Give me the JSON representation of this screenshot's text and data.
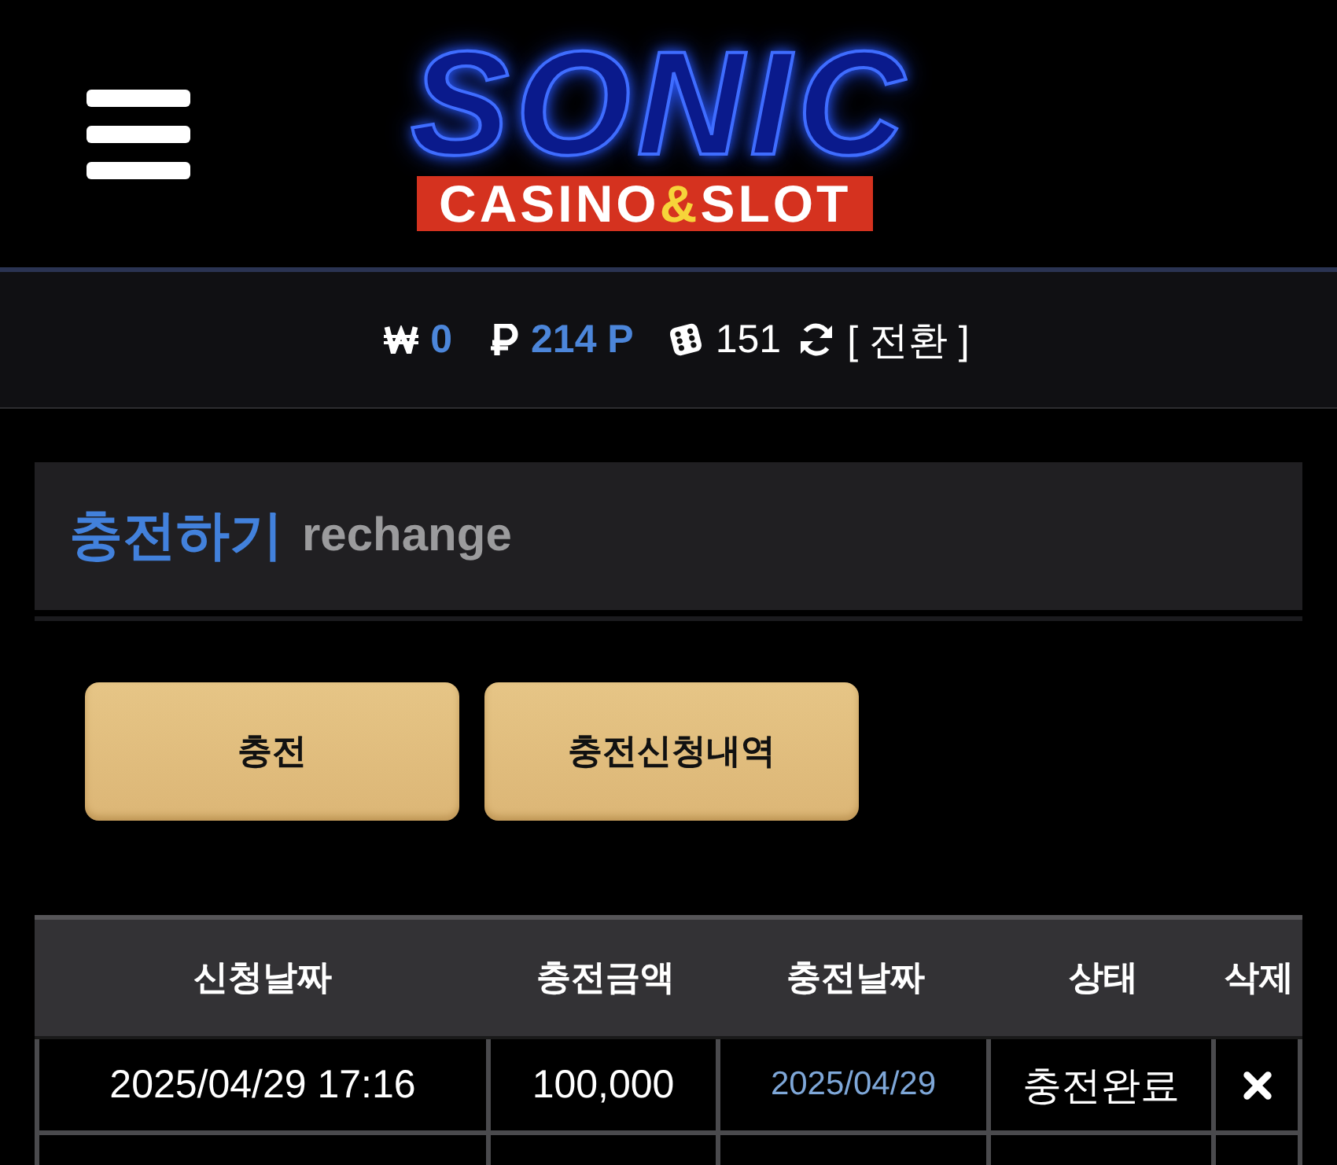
{
  "header": {
    "logo": {
      "title": "SONIC",
      "subtitle_parts": [
        {
          "text": "CASINO",
          "kind": "plain"
        },
        {
          "text": "&",
          "kind": "accent"
        },
        {
          "text": "SLOT",
          "kind": "plain"
        }
      ]
    }
  },
  "balances": [
    {
      "kind": "won",
      "value": "0"
    },
    {
      "kind": "point",
      "value": "214 P"
    },
    {
      "kind": "dice",
      "value": "151"
    }
  ],
  "switch": {
    "label": "[ 전환 ]"
  },
  "section": {
    "title": "충전하기",
    "subtitle": "rechange"
  },
  "buttons": [
    {
      "label": "충전"
    },
    {
      "label": "충전신청내역"
    }
  ],
  "table": {
    "columns": [
      "신청날짜",
      "충전금액",
      "충전날짜",
      "상태",
      "삭제"
    ],
    "rows": [
      {
        "requested_at": "2025/04/29 17:16",
        "amount": "100,000",
        "charged_at": "2025/04/29",
        "status": "충전완료"
      }
    ],
    "more_rows_below": true
  }
}
